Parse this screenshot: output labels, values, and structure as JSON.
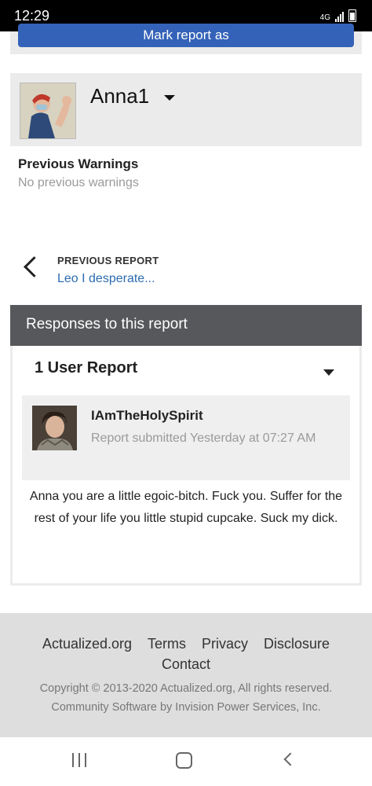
{
  "status": {
    "time": "12:29",
    "network": "4G"
  },
  "top": {
    "mark_button_label": "Mark report as"
  },
  "user": {
    "name": "Anna1"
  },
  "warnings": {
    "title": "Previous Warnings",
    "text": "No previous warnings"
  },
  "prev_report": {
    "label": "PREVIOUS REPORT",
    "link": "Leo I desperate..."
  },
  "responses": {
    "title": "Responses to this report",
    "count_title": "1 User Report",
    "reporter": {
      "name": "IAmTheHolySpirit",
      "meta": "Report submitted Yesterday at 07:27 AM"
    },
    "report_text": "Anna you are a little egoic-bitch. Fuck you. Suffer for the rest of your life you little stupid cupcake. Suck my dick."
  },
  "footer": {
    "links": [
      "Actualized.org",
      "Terms",
      "Privacy",
      "Disclosure",
      "Contact"
    ],
    "copyright": "Copyright © 2013-2020 Actualized.org, All rights reserved.",
    "powered_by": "Community Software by Invision Power Services, Inc."
  }
}
